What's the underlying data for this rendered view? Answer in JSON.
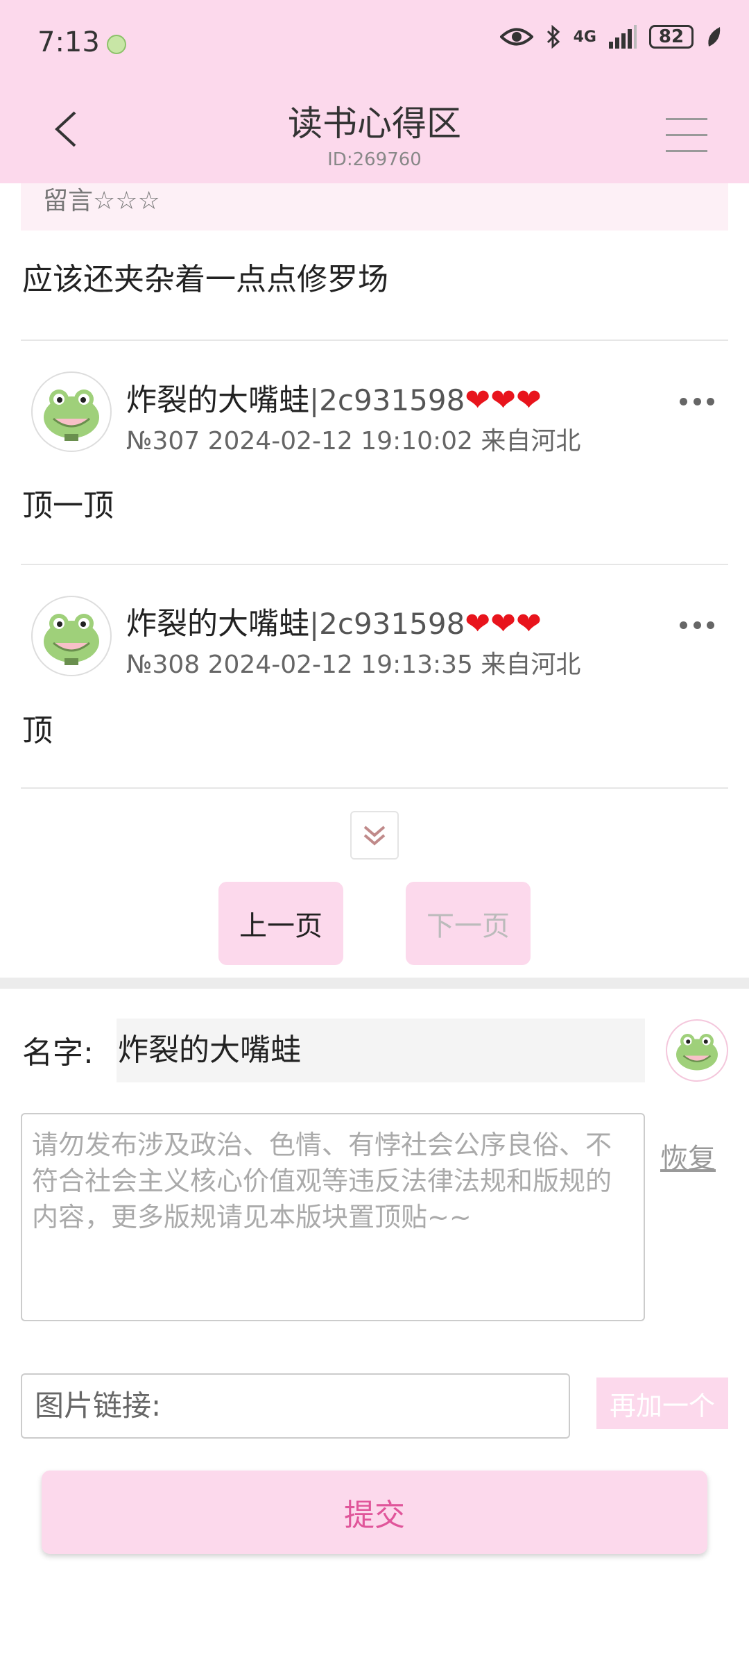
{
  "status_bar": {
    "time": "7:13",
    "network": "4G",
    "battery": "82"
  },
  "header": {
    "title": "读书心得区",
    "id_text": "ID:269760"
  },
  "previous_strip": "留言☆☆☆",
  "previous_post_text": "应该还夹杂着一点点修罗场",
  "posts": [
    {
      "username": "炸裂的大嘴蛙",
      "uid": "|2c931598",
      "hearts": "❤❤❤",
      "meta": "№307 2024-02-12 19:10:02 来自河北",
      "content": "顶一顶"
    },
    {
      "username": "炸裂的大嘴蛙",
      "uid": "|2c931598",
      "hearts": "❤❤❤",
      "meta": "№308 2024-02-12 19:13:35 来自河北",
      "content": "顶"
    }
  ],
  "pagination": {
    "prev_label": "上一页",
    "next_label": "下一页"
  },
  "form": {
    "name_label": "名字:",
    "name_value": "炸裂的大嘴蛙",
    "textarea_placeholder": "请勿发布涉及政治、色情、有悖社会公序良俗、不符合社会主义核心价值观等违反法律法规和版规的内容，更多版规请见本版块置顶贴~~",
    "restore_label": "恢复",
    "image_link_placeholder": "图片链接:",
    "add_more_label": "再加一个",
    "submit_label": "提交"
  },
  "colors": {
    "header_bg": "#fcd9ec",
    "accent_text": "#e0559a",
    "heart": "#e8141c"
  },
  "icons": [
    "back-arrow-icon",
    "menu-icon",
    "more-icon",
    "double-chevron-down-icon",
    "eye-icon",
    "bluetooth-icon",
    "signal-icon",
    "battery-icon",
    "frog-avatar-icon"
  ]
}
